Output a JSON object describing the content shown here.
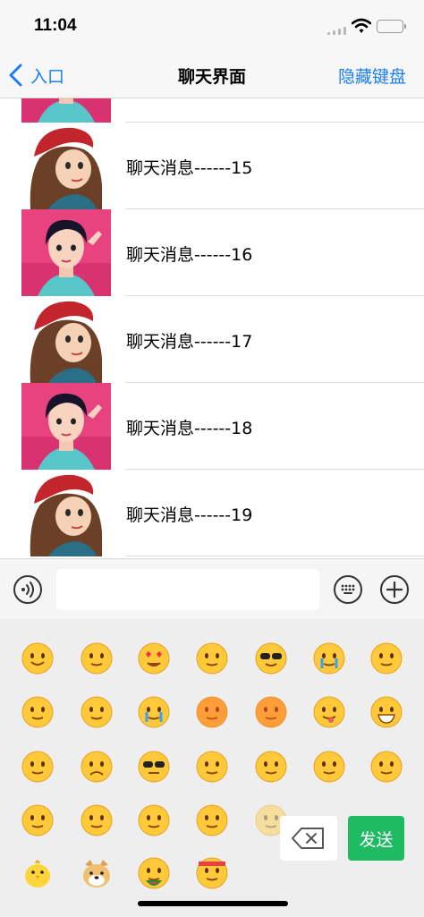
{
  "status_bar": {
    "time": "11:04"
  },
  "nav": {
    "back_label": "入口",
    "title": "聊天界面",
    "right_action": "隐藏键盘"
  },
  "messages": [
    {
      "text": "",
      "avatar": "girl-pink"
    },
    {
      "text": "聊天消息------15",
      "avatar": "girl-red-hat"
    },
    {
      "text": "聊天消息------16",
      "avatar": "girl-pink"
    },
    {
      "text": "聊天消息------17",
      "avatar": "girl-red-hat"
    },
    {
      "text": "聊天消息------18",
      "avatar": "girl-pink"
    },
    {
      "text": "聊天消息------19",
      "avatar": "girl-red-hat"
    }
  ],
  "input_bar": {
    "placeholder": ""
  },
  "emoji_panel": {
    "send_label": "发送",
    "emojis": [
      "smile-emoji",
      "shy-emoji",
      "heart-eyes-emoji",
      "stare-emoji",
      "cool-emoji",
      "crying-emoji",
      "devil-emoji",
      "shush-emoji",
      "sleepy-emoji",
      "sob-emoji",
      "angry-red-emoji",
      "furious-emoji",
      "tongue-emoji",
      "grin-emoji",
      "surprised-emoji",
      "sad-emoji",
      "sunglasses-emoji",
      "wide-eyes-emoji",
      "scream-emoji",
      "drool-emoji",
      "peek-emoji",
      "side-eye-emoji",
      "face-palm-emoji",
      "smirk-emoji",
      "blush-emoji",
      "faded-emoji",
      "chick-emoji",
      "doge-emoji",
      "watermelon-emoji",
      "headband-emoji"
    ]
  },
  "colors": {
    "accent": "#1a7ef2",
    "send": "#1fbb62",
    "emoji_yellow": "#ffc93a"
  }
}
